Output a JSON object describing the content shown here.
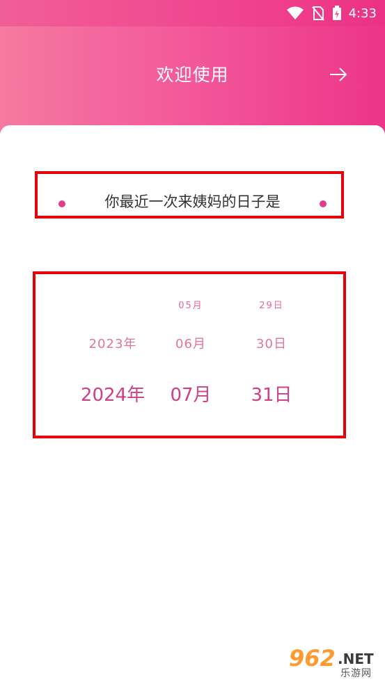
{
  "status_bar": {
    "time": "4:33"
  },
  "header": {
    "title": "欢迎使用"
  },
  "question": {
    "text": "你最近一次来姨妈的日子是"
  },
  "picker": {
    "years": [
      "",
      "2023年",
      "2024年"
    ],
    "months": [
      "05月",
      "06月",
      "07月"
    ],
    "days": [
      "29日",
      "30日",
      "31日"
    ],
    "selected": {
      "year": "2024年",
      "month": "07月",
      "day": "31日"
    }
  },
  "watermark": {
    "number": "962",
    "net": ".NET",
    "site_cn": "乐游网"
  },
  "colors": {
    "accent": "#ec3588",
    "dot": "#e03d8c",
    "selected_text": "#cf3f86",
    "highlight_border": "#e5000a"
  },
  "icons": {
    "wifi": "wifi-icon",
    "no_sim": "no-sim-icon",
    "battery": "battery-charging-icon",
    "next": "arrow-right-icon"
  }
}
